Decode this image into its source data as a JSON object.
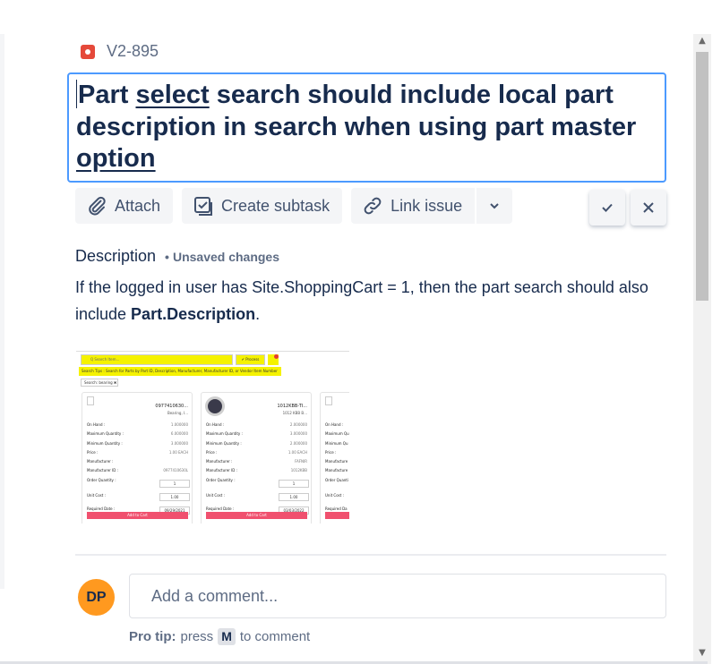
{
  "issue": {
    "key": "V2-895",
    "type_icon": "bug-icon",
    "title_line1_prefix": "Part ",
    "title_line1_spell": "select",
    "title_line1_suffix": " search should include local part",
    "title_line2": "description in search when using part master",
    "title_line3_spell": "option"
  },
  "actions": {
    "attach": "Attach",
    "create_subtask": "Create subtask",
    "link_issue": "Link issue"
  },
  "description": {
    "label": "Description",
    "unsaved": "Unsaved changes",
    "text_part1": "If the logged in user has Site.ShoppingCart = 1, then the part search should also include ",
    "text_bold": "Part.Description",
    "text_end": "."
  },
  "embedded_screenshot": {
    "search_placeholder": "Q Search Item...",
    "process_label": "✔ Process",
    "search_tips": "Search Tips : Search for Parts by Part ID, Description, Manufacturer, Manufacturer ID, or Vendor Item Number",
    "filter_chip": "Search: bearing ✖",
    "cards": [
      {
        "title": "0977410630...",
        "subtitle": "Bearing, I...",
        "rows": [
          {
            "label": "On Hand :",
            "value": "1.000000"
          },
          {
            "label": "Maximum Quantity :",
            "value": "6.000000"
          },
          {
            "label": "Minimum Quantity :",
            "value": "3.000000"
          },
          {
            "label": "Price :",
            "value": "1.00 EACH"
          },
          {
            "label": "Manufacturer :",
            "value": ""
          },
          {
            "label": "Manufacturer ID :",
            "value": "0977410630L"
          }
        ],
        "order_qty_label": "Order Quantity :",
        "order_qty": "1",
        "unit_cost_label": "Unit Cost :",
        "unit_cost": "1.00",
        "required_date_label": "Required Date :",
        "required_date": "09/29/2021",
        "add_button": "Add to Cart"
      },
      {
        "title": "1012KBB-TI...",
        "subtitle": "1012 KBB B...",
        "rows": [
          {
            "label": "On Hand :",
            "value": "2.000000"
          },
          {
            "label": "Maximum Quantity :",
            "value": "3.000000"
          },
          {
            "label": "Minimum Quantity :",
            "value": "2.000000"
          },
          {
            "label": "Price :",
            "value": "1.00 EACH"
          },
          {
            "label": "Manufacturer :",
            "value": "FAFNIR"
          },
          {
            "label": "Manufacturer ID :",
            "value": "1012KBB"
          }
        ],
        "order_qty_label": "Order Quantity :",
        "order_qty": "1",
        "unit_cost_label": "Unit Cost :",
        "unit_cost": "1.00",
        "required_date_label": "Required Date :",
        "required_date": "03/03/2022",
        "add_button": "Add to Cart"
      },
      {
        "title": "",
        "subtitle": "",
        "rows": [
          {
            "label": "On Hand :",
            "value": ""
          },
          {
            "label": "Maximum Qu",
            "value": ""
          },
          {
            "label": "Minimum Qu",
            "value": ""
          },
          {
            "label": "Price :",
            "value": ""
          },
          {
            "label": "Manufacture",
            "value": ""
          },
          {
            "label": "Manufacture",
            "value": ""
          }
        ],
        "order_qty_label": "Order Quanti",
        "order_qty": "",
        "unit_cost_label": "Unit Cost :",
        "unit_cost": "",
        "required_date_label": "Required Da",
        "required_date": "",
        "add_button": ""
      }
    ]
  },
  "comment": {
    "avatar_initials": "DP",
    "placeholder": "Add a comment...",
    "protip_label": "Pro tip:",
    "protip_press": "press",
    "protip_key": "M",
    "protip_suffix": "to comment"
  },
  "colors": {
    "bug": "#e5493a",
    "focus_border": "#4c9aff",
    "avatar_bg": "#ff991f"
  }
}
